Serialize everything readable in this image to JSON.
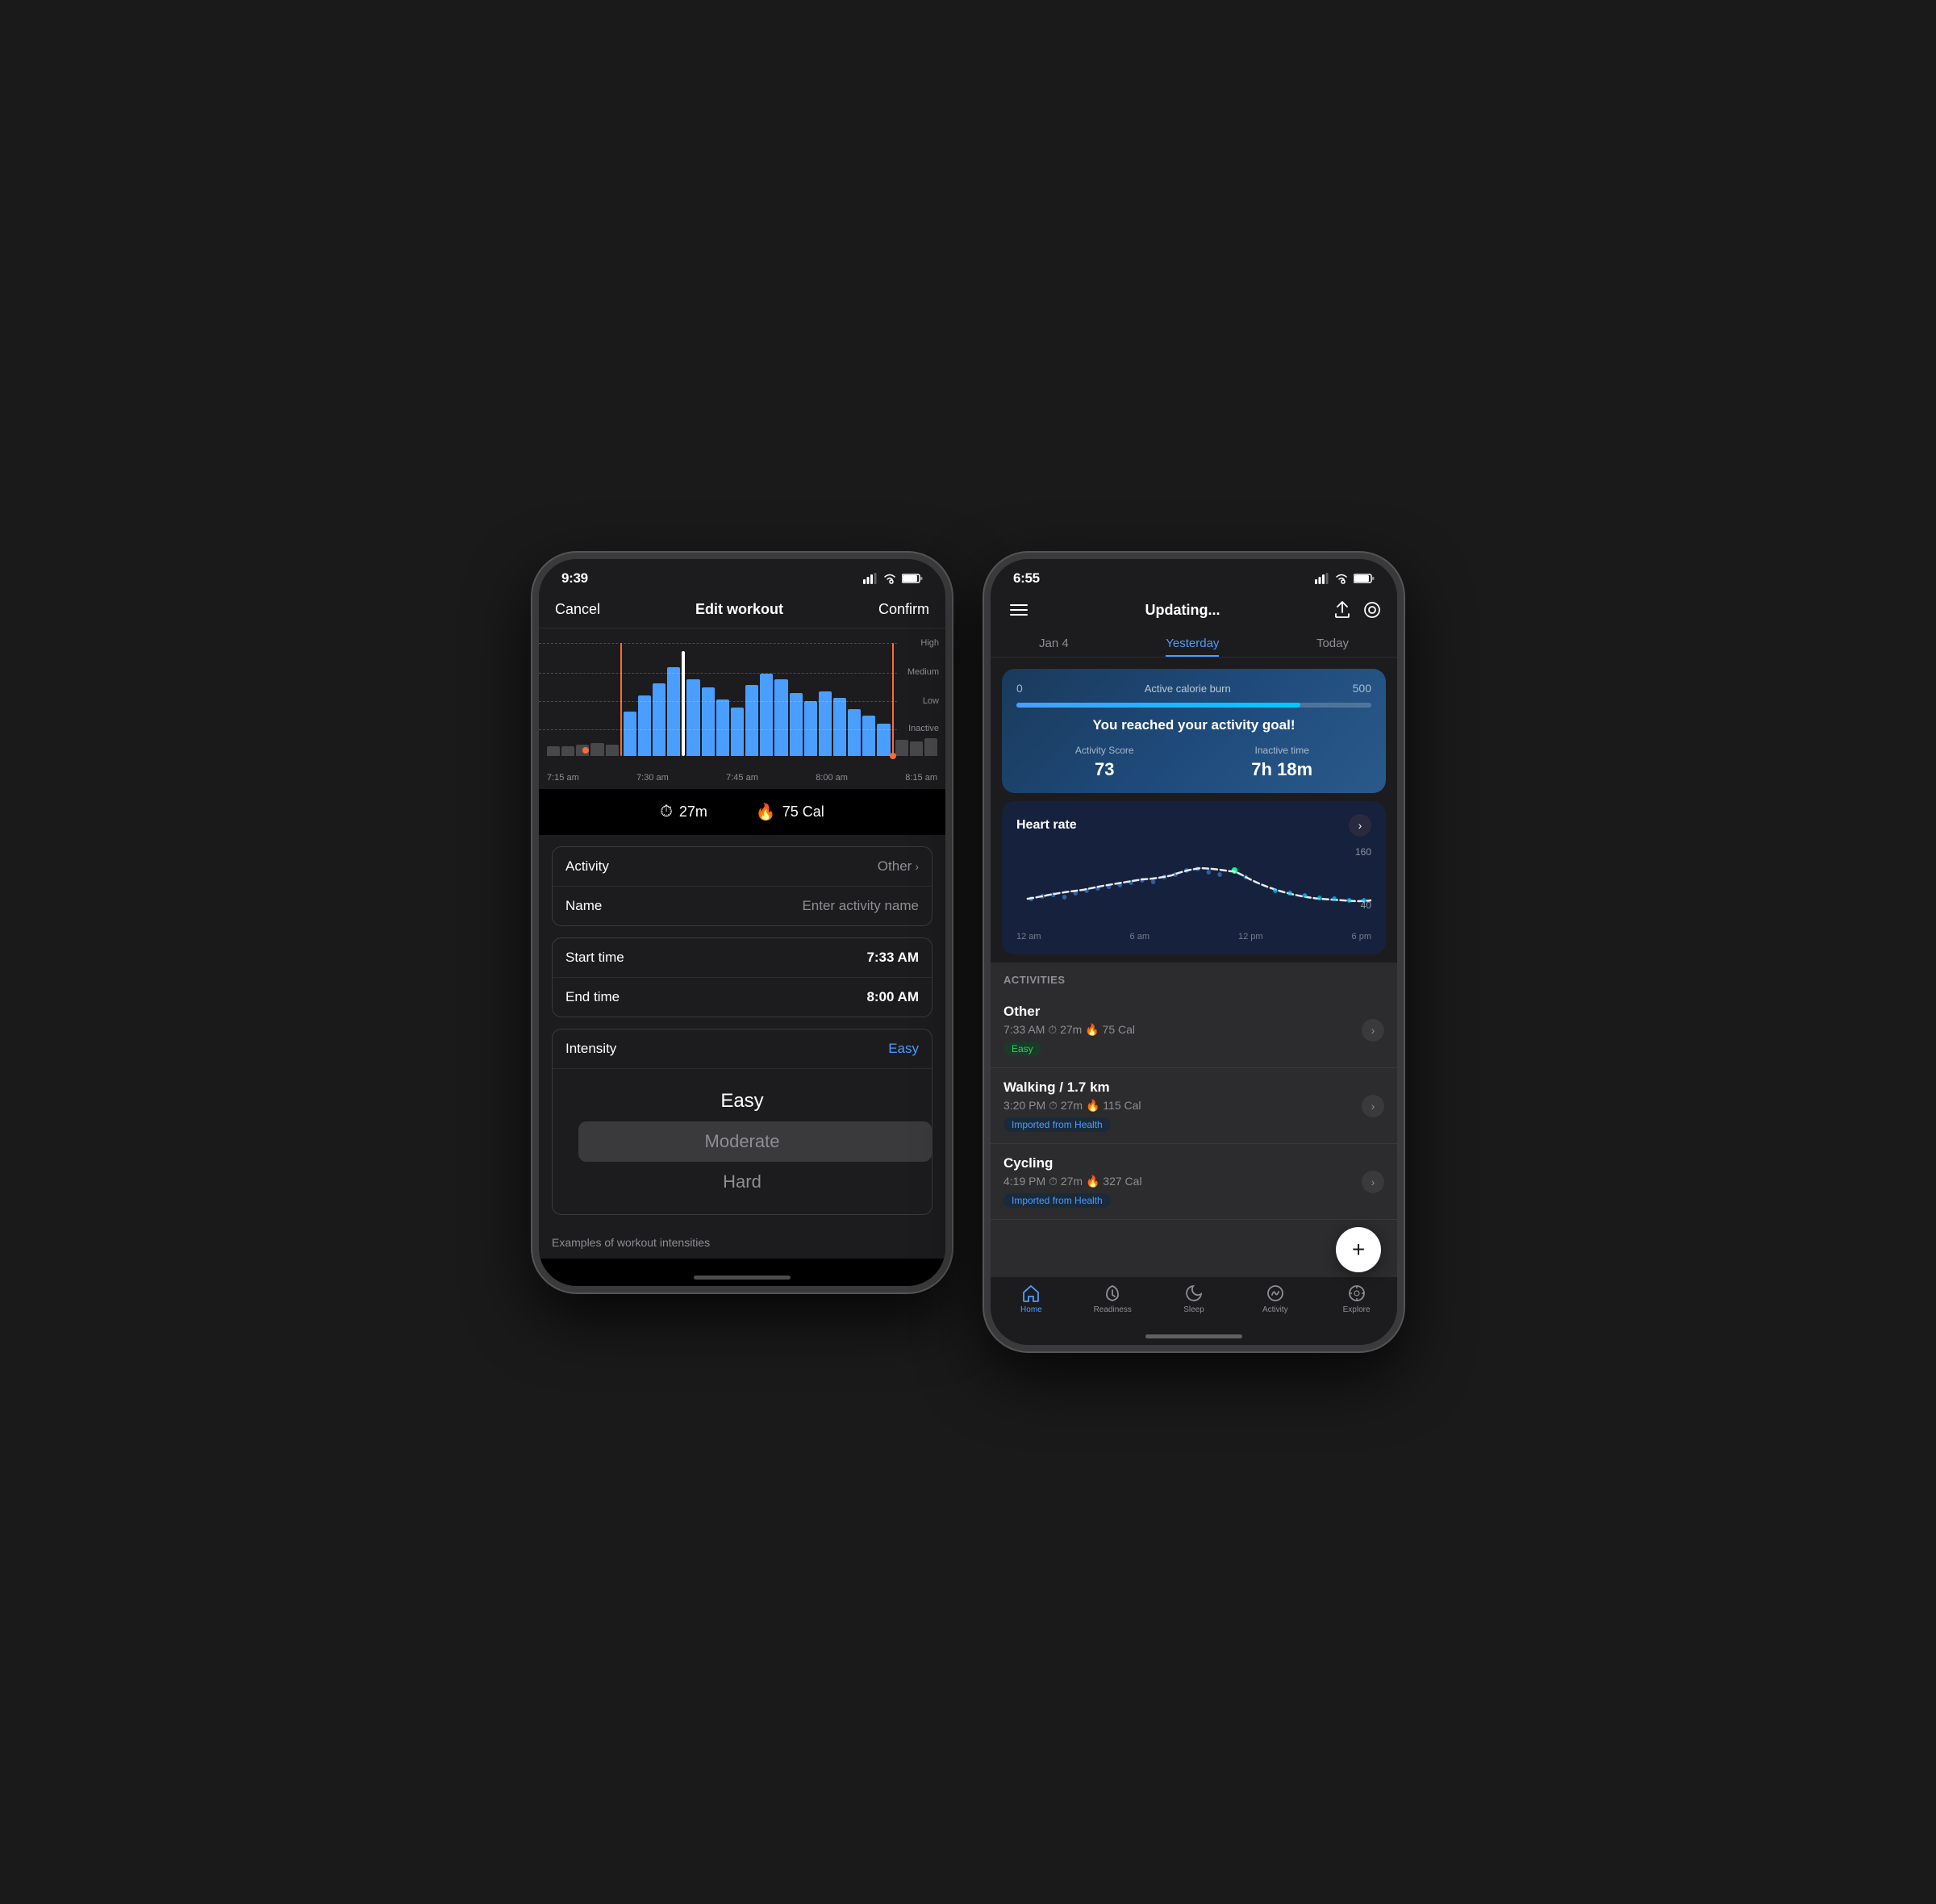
{
  "phone1": {
    "status_time": "9:39",
    "nav": {
      "cancel": "Cancel",
      "title": "Edit workout",
      "confirm": "Confirm"
    },
    "chart": {
      "labels": [
        "High",
        "Medium",
        "Low",
        "Inactive"
      ],
      "times": [
        "7:15 am",
        "7:30 am",
        "7:45 am",
        "8:00 am",
        "8:15 am"
      ]
    },
    "stats": {
      "duration": "27m",
      "calories": "75 Cal"
    },
    "activity_label": "Activity",
    "activity_value": "Other",
    "name_label": "Name",
    "name_placeholder": "Enter activity name",
    "start_label": "Start time",
    "start_value": "7:33 AM",
    "end_label": "End time",
    "end_value": "8:00 AM",
    "intensity_label": "Intensity",
    "intensity_value": "Easy",
    "picker": {
      "options": [
        "Easy",
        "Moderate",
        "Hard"
      ],
      "selected": "Easy"
    },
    "examples_text": "Examples of workout intensities"
  },
  "phone2": {
    "status_time": "6:55",
    "nav": {
      "title": "Updating..."
    },
    "date_tabs": {
      "prev": "Jan 4",
      "current": "Yesterday",
      "next": "Today"
    },
    "activity_goal": {
      "calorie_start": "0",
      "calorie_end": "500",
      "title": "Active calorie burn",
      "goal_text": "You reached your activity goal!",
      "score_label": "Activity Score",
      "score_value": "73",
      "inactive_label": "Inactive time",
      "inactive_value": "7h 18m"
    },
    "heart_rate": {
      "title": "Heart rate",
      "high_value": "160",
      "low_value": "40",
      "times": [
        "12 am",
        "6 am",
        "12 pm",
        "6 pm"
      ]
    },
    "activities_header": "ACTIVITIES",
    "activities": [
      {
        "name": "Other",
        "time": "7:33 AM",
        "duration": "27m",
        "calories": "75 Cal",
        "tag": "Easy",
        "tag_type": "easy"
      },
      {
        "name": "Walking / 1.7 km",
        "time": "3:20 PM",
        "duration": "27m",
        "calories": "115 Cal",
        "tag": "Imported from Health",
        "tag_type": "imported"
      },
      {
        "name": "Cycling",
        "time": "4:19 PM",
        "duration": "27m",
        "calories": "327 Cal",
        "tag": "Imported from Health",
        "tag_type": "imported"
      }
    ],
    "fab_label": "+",
    "tabs": [
      {
        "label": "Home",
        "icon": "home",
        "active": true
      },
      {
        "label": "Readiness",
        "icon": "readiness",
        "active": false
      },
      {
        "label": "Sleep",
        "icon": "sleep",
        "active": false
      },
      {
        "label": "Activity",
        "icon": "activity",
        "active": false
      },
      {
        "label": "Explore",
        "icon": "explore",
        "active": false
      }
    ]
  }
}
